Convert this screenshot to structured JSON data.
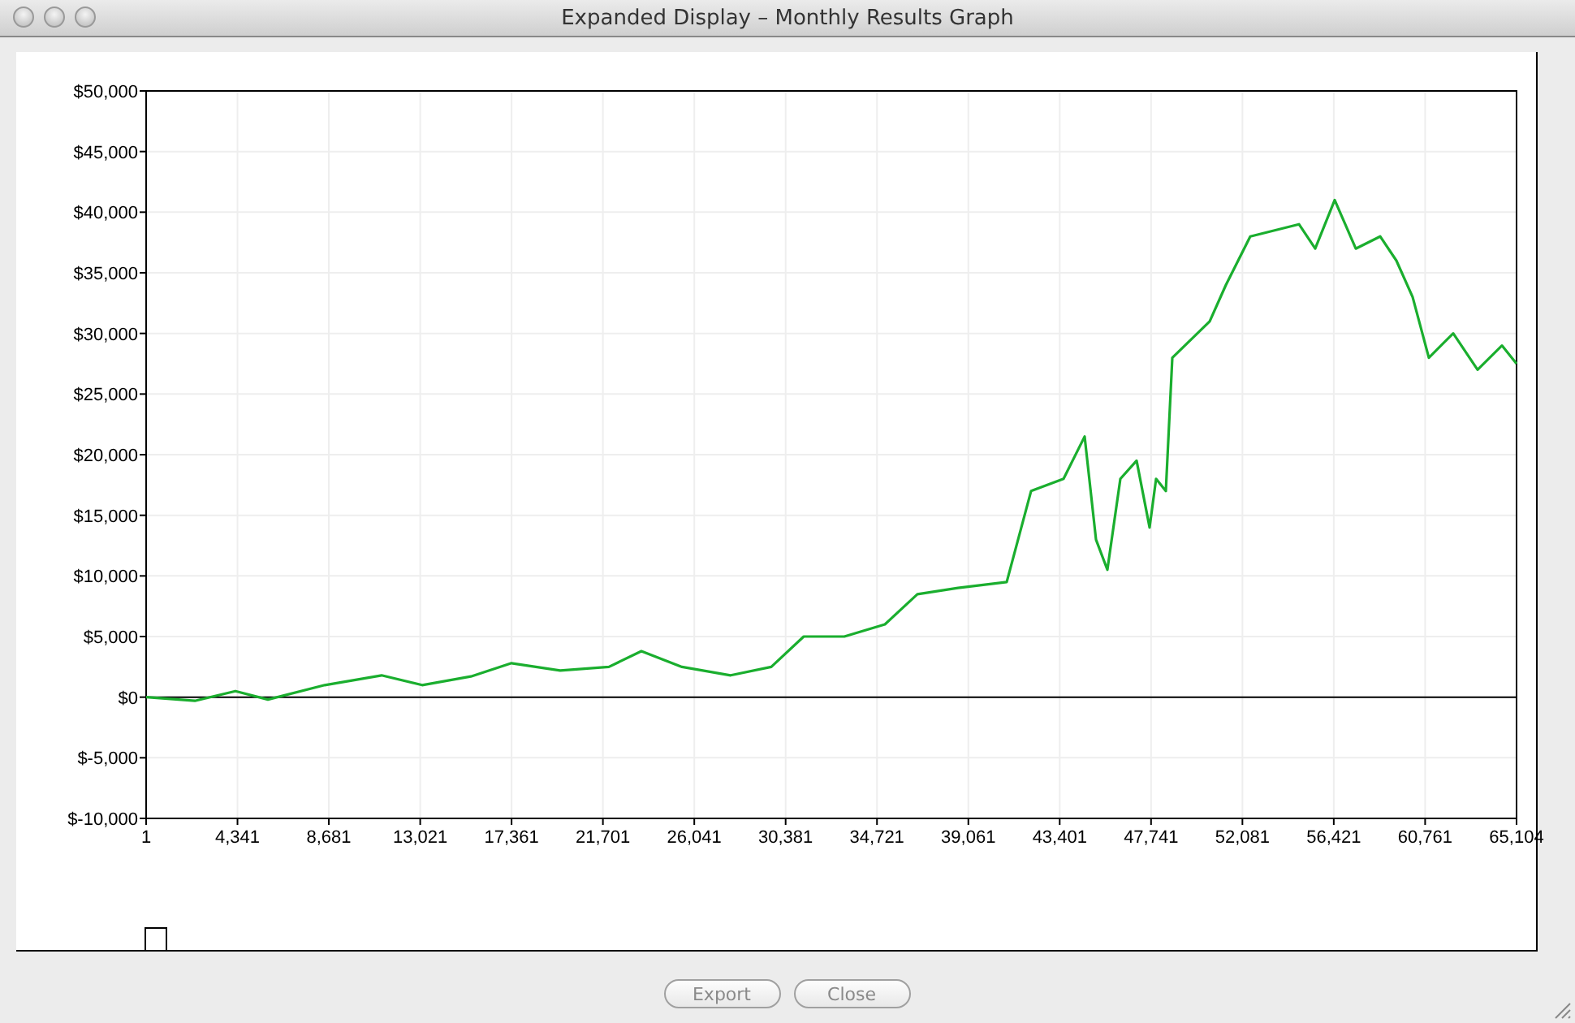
{
  "window": {
    "title": "Expanded Display – Monthly Results Graph"
  },
  "graph": {
    "chart_data": {
      "type": "line",
      "x": [
        1,
        2315,
        4244,
        5787,
        8486,
        11186,
        13114,
        15428,
        17357,
        19671,
        21985,
        23528,
        25457,
        27771,
        29699,
        31242,
        33170,
        35099,
        36641,
        38570,
        40884,
        42041,
        43584,
        44587,
        45127,
        45667,
        46284,
        47055,
        47672,
        47981,
        48444,
        48752,
        50526,
        51298,
        52455,
        54769,
        55540,
        56466,
        57469,
        58626,
        59397,
        60169,
        60940,
        62097,
        63254,
        64411,
        65104
      ],
      "series": [
        {
          "color": "#1aae2e",
          "values": [
            0,
            -300,
            500,
            -200,
            1000,
            1800,
            1000,
            1700,
            2800,
            2200,
            2500,
            3800,
            2500,
            1800,
            2500,
            5000,
            5000,
            6000,
            8500,
            9000,
            9500,
            17000,
            18000,
            21500,
            13000,
            10500,
            18000,
            19500,
            14000,
            18000,
            17000,
            28000,
            31000,
            34000,
            38000,
            39000,
            37000,
            41000,
            37000,
            38000,
            36000,
            33000,
            28000,
            30000,
            27000,
            29000,
            27500
          ]
        }
      ],
      "xlim": [
        1,
        65104
      ],
      "ylim": [
        -10000,
        50000
      ],
      "xticks": [
        1,
        {
          "value": 4341,
          "label": "4,341"
        },
        {
          "value": 8681,
          "label": "8,681"
        },
        {
          "value": 13021,
          "label": "13,021"
        },
        {
          "value": 17361,
          "label": "17,361"
        },
        {
          "value": 21701,
          "label": "21,701"
        },
        {
          "value": 26041,
          "label": "26,041"
        },
        {
          "value": 30381,
          "label": "30,381"
        },
        {
          "value": 34721,
          "label": "34,721"
        },
        {
          "value": 39061,
          "label": "39,061"
        },
        {
          "value": 43401,
          "label": "43,401"
        },
        {
          "value": 47741,
          "label": "47,741"
        },
        {
          "value": 52081,
          "label": "52,081"
        },
        {
          "value": 56421,
          "label": "56,421"
        },
        {
          "value": 60761,
          "label": "60,761"
        },
        {
          "value": 65104,
          "label": "65,104"
        }
      ],
      "grid": true,
      "yticks": [
        {
          "value": -10000,
          "label": "$-10,000"
        },
        {
          "value": -5000,
          "label": "$-5,000"
        },
        {
          "value": 0,
          "label": "$0"
        },
        {
          "value": 5000,
          "label": "$5,000"
        },
        {
          "value": 10000,
          "label": "$10,000"
        },
        {
          "value": 15000,
          "label": "$15,000"
        },
        {
          "value": 20000,
          "label": "$20,000"
        },
        {
          "value": 25000,
          "label": "$25,000"
        },
        {
          "value": 30000,
          "label": "$30,000"
        },
        {
          "value": 35000,
          "label": "$35,000"
        },
        {
          "value": 40000,
          "label": "$40,000"
        },
        {
          "value": 45000,
          "label": "$45,000"
        },
        {
          "value": 50000,
          "label": "$50,000"
        }
      ]
    }
  },
  "buttons": [
    {
      "label": "Export",
      "disabled": true
    },
    {
      "label": "Close",
      "disabled": true
    }
  ]
}
